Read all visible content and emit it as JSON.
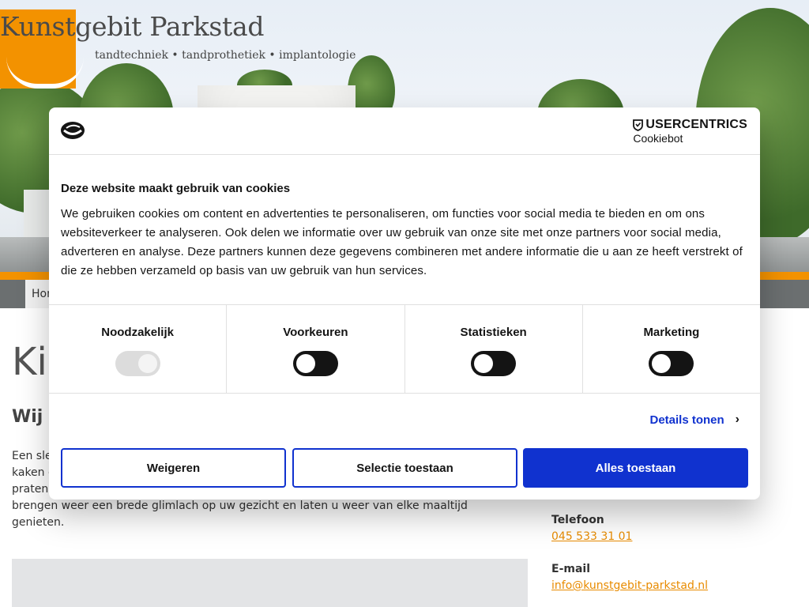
{
  "header": {
    "logo_title": "Kunstgebit Parkstad",
    "logo_subtitle": "tandtechniek • tandprothetiek • implantologie",
    "nav_home": "Home"
  },
  "main": {
    "heading_partial": "Kie",
    "subheading_partial": "Wij z",
    "paragraph_lines": [
      "Een sle",
      "kaken e",
      "praten",
      "brengen weer een brede glimlach op uw gezicht en laten u weer van elke maaltijd genieten."
    ]
  },
  "sidebar": {
    "phone_label": "Telefoon",
    "phone_value": "045 533 31 01",
    "email_label": "E-mail",
    "email_value": "info@kunstgebit-parkstad.nl"
  },
  "cookie_banner": {
    "brand_top": "USERCENTRICS",
    "brand_bottom": "Cookiebot",
    "title": "Deze website maakt gebruik van cookies",
    "body": "We gebruiken cookies om content en advertenties te personaliseren, om functies voor social media te bieden en om ons websiteverkeer te analyseren. Ook delen we informatie over uw gebruik van onze site met onze partners voor social media, adverteren en analyse. Deze partners kunnen deze gegevens combineren met andere informatie die u aan ze heeft verstrekt of die ze hebben verzameld op basis van uw gebruik van hun services.",
    "categories": [
      {
        "label": "Noodzakelijk",
        "enabled": true,
        "disabled": true
      },
      {
        "label": "Voorkeuren",
        "enabled": false,
        "disabled": false
      },
      {
        "label": "Statistieken",
        "enabled": false,
        "disabled": false
      },
      {
        "label": "Marketing",
        "enabled": false,
        "disabled": false
      }
    ],
    "details_label": "Details tonen",
    "buttons": {
      "deny": "Weigeren",
      "selection": "Selectie toestaan",
      "allow_all": "Alles toestaan"
    },
    "colors": {
      "accent": "#1032cf",
      "brand_orange": "#f39200"
    }
  }
}
